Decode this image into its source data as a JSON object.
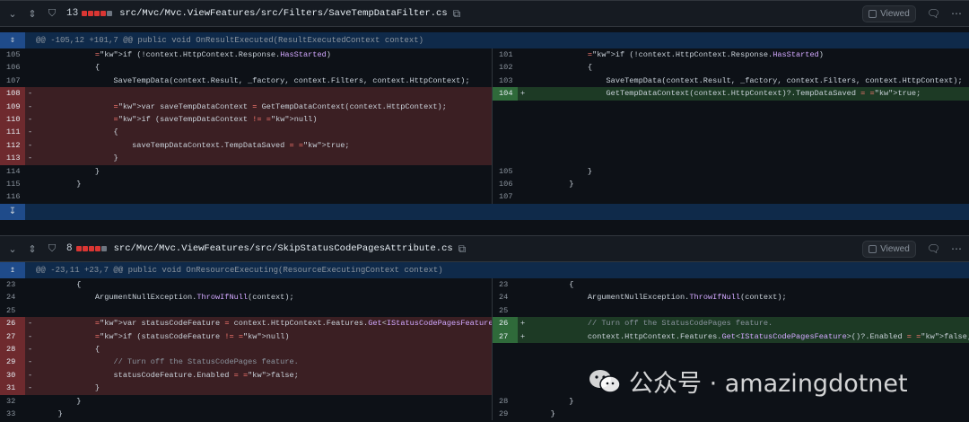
{
  "files": [
    {
      "count": "13",
      "path": "src/Mvc/Mvc.ViewFeatures/src/Filters/SaveTempDataFilter.cs",
      "viewed_label": "Viewed",
      "hunk": "@@ -105,12 +101,7 @@ public void OnResultExecuted(ResultExecutedContext context)",
      "left": [
        {
          "n": "105",
          "t": "ctx",
          "m": "",
          "c": "            if (!context.HttpContext.Response.HasStarted)"
        },
        {
          "n": "106",
          "t": "ctx",
          "m": "",
          "c": "            {"
        },
        {
          "n": "107",
          "t": "ctx",
          "m": "",
          "c": "                SaveTempData(context.Result, _factory, context.Filters, context.HttpContext);"
        },
        {
          "n": "108",
          "t": "del",
          "m": "-",
          "c": ""
        },
        {
          "n": "109",
          "t": "del",
          "m": "-",
          "c": "                var saveTempDataContext = GetTempDataContext(context.HttpContext);"
        },
        {
          "n": "110",
          "t": "del",
          "m": "-",
          "c": "                if (saveTempDataContext != null)"
        },
        {
          "n": "111",
          "t": "del",
          "m": "-",
          "c": "                {"
        },
        {
          "n": "112",
          "t": "del",
          "m": "-",
          "c": "                    saveTempDataContext.TempDataSaved = true;"
        },
        {
          "n": "113",
          "t": "del",
          "m": "-",
          "c": "                }"
        },
        {
          "n": "114",
          "t": "ctx",
          "m": "",
          "c": "            }"
        },
        {
          "n": "115",
          "t": "ctx",
          "m": "",
          "c": "        }"
        },
        {
          "n": "116",
          "t": "ctx",
          "m": "",
          "c": ""
        }
      ],
      "right": [
        {
          "n": "101",
          "t": "ctx",
          "m": "",
          "c": "            if (!context.HttpContext.Response.HasStarted)"
        },
        {
          "n": "102",
          "t": "ctx",
          "m": "",
          "c": "            {"
        },
        {
          "n": "103",
          "t": "ctx",
          "m": "",
          "c": "                SaveTempData(context.Result, _factory, context.Filters, context.HttpContext);"
        },
        {
          "n": "104",
          "t": "add",
          "m": "+",
          "c": "                GetTempDataContext(context.HttpContext)?.TempDataSaved = true;"
        },
        {
          "n": "",
          "t": "empty",
          "m": "",
          "c": ""
        },
        {
          "n": "",
          "t": "empty",
          "m": "",
          "c": ""
        },
        {
          "n": "",
          "t": "empty",
          "m": "",
          "c": ""
        },
        {
          "n": "",
          "t": "empty",
          "m": "",
          "c": ""
        },
        {
          "n": "",
          "t": "empty",
          "m": "",
          "c": ""
        },
        {
          "n": "105",
          "t": "ctx",
          "m": "",
          "c": "            }"
        },
        {
          "n": "106",
          "t": "ctx",
          "m": "",
          "c": "        }"
        },
        {
          "n": "107",
          "t": "ctx",
          "m": "",
          "c": ""
        }
      ]
    },
    {
      "count": "8",
      "path": "src/Mvc/Mvc.ViewFeatures/src/SkipStatusCodePagesAttribute.cs",
      "viewed_label": "Viewed",
      "hunk": "@@ -23,11 +23,7 @@ public void OnResourceExecuting(ResourceExecutingContext context)",
      "left": [
        {
          "n": "23",
          "t": "ctx",
          "m": "",
          "c": "        {"
        },
        {
          "n": "24",
          "t": "ctx",
          "m": "",
          "c": "            ArgumentNullException.ThrowIfNull(context);"
        },
        {
          "n": "25",
          "t": "ctx",
          "m": "",
          "c": ""
        },
        {
          "n": "26",
          "t": "del",
          "m": "-",
          "c": "            var statusCodeFeature = context.HttpContext.Features.Get<IStatusCodePagesFeature>();"
        },
        {
          "n": "27",
          "t": "del",
          "m": "-",
          "c": "            if (statusCodeFeature != null)"
        },
        {
          "n": "28",
          "t": "del",
          "m": "-",
          "c": "            {"
        },
        {
          "n": "29",
          "t": "del",
          "m": "-",
          "c": "                // Turn off the StatusCodePages feature."
        },
        {
          "n": "30",
          "t": "del",
          "m": "-",
          "c": "                statusCodeFeature.Enabled = false;"
        },
        {
          "n": "31",
          "t": "del",
          "m": "-",
          "c": "            }"
        },
        {
          "n": "32",
          "t": "ctx",
          "m": "",
          "c": "        }"
        },
        {
          "n": "33",
          "t": "ctx",
          "m": "",
          "c": "    }"
        }
      ],
      "right": [
        {
          "n": "23",
          "t": "ctx",
          "m": "",
          "c": "        {"
        },
        {
          "n": "24",
          "t": "ctx",
          "m": "",
          "c": "            ArgumentNullException.ThrowIfNull(context);"
        },
        {
          "n": "25",
          "t": "ctx",
          "m": "",
          "c": ""
        },
        {
          "n": "26",
          "t": "add",
          "m": "+",
          "c": "            // Turn off the StatusCodePages feature."
        },
        {
          "n": "27",
          "t": "add",
          "m": "+",
          "c": "            context.HttpContext.Features.Get<IStatusCodePagesFeature>()?.Enabled = false;"
        },
        {
          "n": "",
          "t": "empty",
          "m": "",
          "c": ""
        },
        {
          "n": "",
          "t": "empty",
          "m": "",
          "c": ""
        },
        {
          "n": "",
          "t": "empty",
          "m": "",
          "c": ""
        },
        {
          "n": "",
          "t": "empty",
          "m": "",
          "c": ""
        },
        {
          "n": "28",
          "t": "ctx",
          "m": "",
          "c": "        }"
        },
        {
          "n": "29",
          "t": "ctx",
          "m": "",
          "c": "    }"
        }
      ]
    }
  ],
  "watermark": {
    "text": "公众号 · amazingdotnet"
  }
}
